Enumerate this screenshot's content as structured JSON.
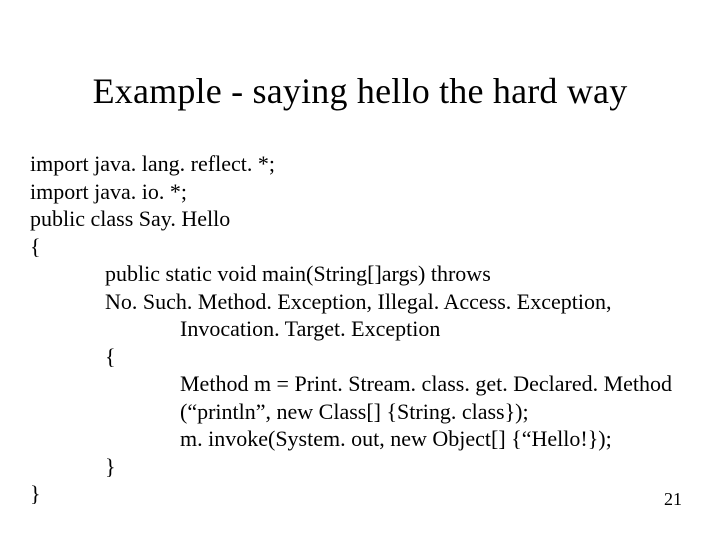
{
  "title": "Example - saying hello the hard way",
  "code": {
    "l1": "import java. lang. reflect. *;",
    "l2": "import java. io. *;",
    "l3": "public class Say. Hello",
    "l4": "{",
    "l5": "public static void main(String[]args) throws",
    "l6": "No. Such. Method. Exception, Illegal. Access. Exception,",
    "l7": "Invocation. Target. Exception",
    "l8": "{",
    "l9": "Method m = Print. Stream. class. get. Declared. Method",
    "l10": "(“println”, new Class[] {String. class});",
    "l11": "m. invoke(System. out, new Object[] {“Hello!});",
    "l12": "}",
    "l13": "}"
  },
  "page_number": "21"
}
